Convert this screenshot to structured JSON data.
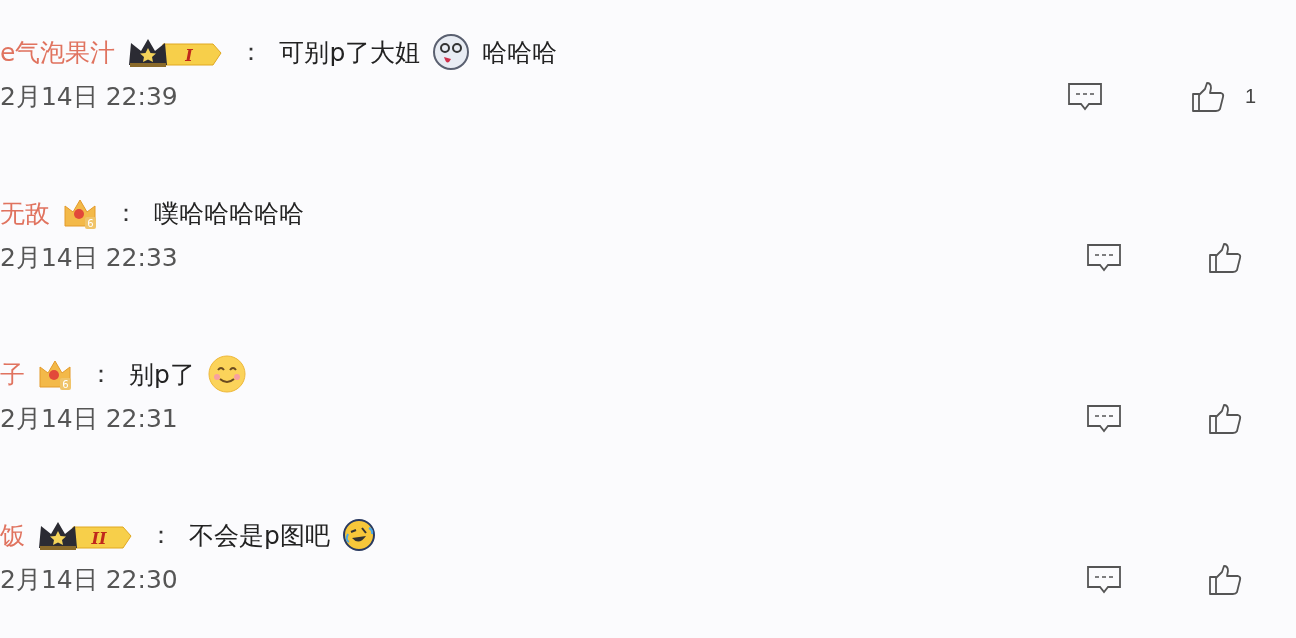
{
  "comments": [
    {
      "user": "e气泡果汁",
      "badge": {
        "kind": "crown-bar",
        "text": "I"
      },
      "separator": "：",
      "content": [
        {
          "kind": "text",
          "text": "可别p了大姐"
        },
        {
          "kind": "ghost-emoji"
        },
        {
          "kind": "text",
          "text": "哈哈哈"
        }
      ],
      "time": "2月14日 22:39",
      "likes": "1"
    },
    {
      "user": "无敌",
      "badge": {
        "kind": "crown-small",
        "text": "6"
      },
      "separator": "：",
      "content": [
        {
          "kind": "text",
          "text": "噗哈哈哈哈哈"
        }
      ],
      "time": "2月14日 22:33"
    },
    {
      "user": "子",
      "badge": {
        "kind": "crown-small",
        "text": "6"
      },
      "separator": "：",
      "content": [
        {
          "kind": "text",
          "text": "别p了"
        },
        {
          "kind": "smile-emoji"
        }
      ],
      "time": "2月14日 22:31"
    },
    {
      "user": "饭",
      "badge": {
        "kind": "crown-bar",
        "text": "II"
      },
      "separator": "：",
      "content": [
        {
          "kind": "text",
          "text": "不会是p图吧"
        },
        {
          "kind": "laugh-emoji"
        }
      ],
      "time": "2月14日 22:30"
    }
  ]
}
